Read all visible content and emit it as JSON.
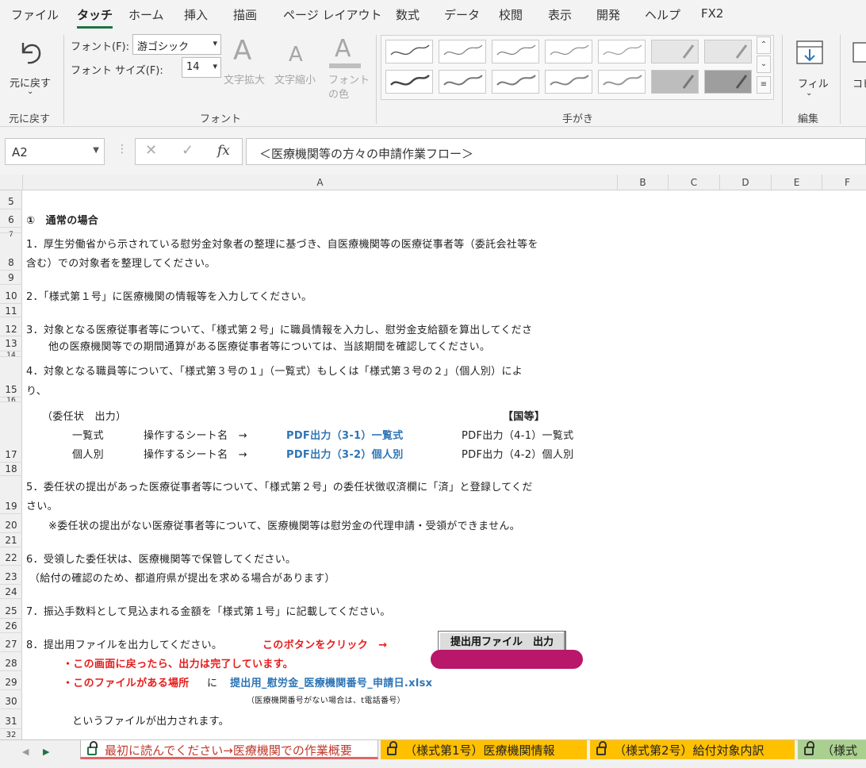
{
  "menu": {
    "tabs": [
      "ファイル",
      "タッチ",
      "ホーム",
      "挿入",
      "描画",
      "ページ レイアウト",
      "数式",
      "データ",
      "校閲",
      "表示",
      "開発",
      "ヘルプ",
      "FX2"
    ],
    "active": "タッチ"
  },
  "ribbon": {
    "undo": {
      "label": "元に戻す",
      "group": "元に戻す"
    },
    "font": {
      "font_label": "フォント(F):",
      "font_value": "游ゴシック",
      "size_label": "フォント サイズ(F):",
      "size_value": "14",
      "grow": "文字拡大",
      "shrink": "文字縮小",
      "color_line1": "フォント",
      "color_line2": "の色",
      "group": "フォント"
    },
    "handwriting": {
      "group": "手がき"
    },
    "edit": {
      "fill": "フィル",
      "group": "編集",
      "copy_partial": "コピ"
    }
  },
  "formula_bar": {
    "namebox": "A2",
    "fx": "fx",
    "formula": "＜医療機関等の方々の申請作業フロー＞"
  },
  "columns": [
    "A",
    "B",
    "C",
    "D",
    "E",
    "F"
  ],
  "rows": [
    "5",
    "6",
    "7",
    "8",
    "9",
    "10",
    "11",
    "12",
    "13",
    "14",
    "15",
    "16",
    "17",
    "18",
    "19",
    "20",
    "21",
    "22",
    "23",
    "24",
    "25",
    "26",
    "27",
    "28",
    "29",
    "30",
    "31",
    "32"
  ],
  "content": {
    "s1": "①　通常の場合",
    "p1a": "1．厚生労働省から示されている慰労金対象者の整理に基づき、自医療機関等の医療従事者等（委託会社等を",
    "p1b": "含む）での対象者を整理してください。",
    "p2": "2．「様式第１号」に医療機関の情報等を入力してください。",
    "p3a": "3．対象となる医療従事者等について、「様式第２号」に職員情報を入力し、慰労金支給額を算出してくださ",
    "p3b": "他の医療機関等での期間通算がある医療従事者等については、当該期間を確認してください。",
    "p4a": "4．対象となる職員等について、「様式第３号の１」（一覧式）もしくは「様式第３号の２」（個人別）によ",
    "p4b": "り、",
    "tbl_head_left": "（委任状　出力）",
    "tbl_head_right": "【国等】",
    "r1_type": "一覧式",
    "r1_op": "操作するシート名　→",
    "r1_link": "PDF出力（3-1）一覧式",
    "r1_gov": "PDF出力（4-1）一覧式",
    "r2_type": "個人別",
    "r2_op": "操作するシート名　→",
    "r2_link": "PDF出力（3-2）個人別",
    "r2_gov": "PDF出力（4-2）個人別",
    "p5a": "5．委任状の提出があった医療従事者等について、「様式第２号」の委任状徴収済欄に「済」と登録してくだ",
    "p5b": "さい。",
    "p5c": "※委任状の提出がない医療従事者等について、医療機関等は慰労金の代理申請・受領ができません。",
    "p6a": "6．受領した委任状は、医療機関等で保管してください。",
    "p6b": "（給付の確認のため、都道府県が提出を求める場合があります）",
    "p7": "7．振込手数料として見込まれる金額を「様式第１号」に記載してください。",
    "p8": "8．提出用ファイルを出力してください。",
    "p8_click": "このボタンをクリック　→",
    "p8_button": "提出用ファイル　出力",
    "p8_done": "・この画面に戻ったら、出力は完了しています。",
    "p8_loc_bullet": "・このファイルがある場所",
    "p8_loc_ni": "に",
    "p8_filename": "提出用_慰労金_医療機関番号_申請日.xlsx",
    "p8_note": "（医療機関番号がない場合は、t電話番号）",
    "p8_result": "というファイルが出力されます。"
  },
  "sheet_tabs": [
    {
      "label": "最初に読んでください→医療機関での作業概要",
      "color": "#ffffff",
      "text": "#c0392b",
      "underline": "#e06666",
      "locked": true
    },
    {
      "label": "（様式第1号）医療機関情報",
      "color": "#ffc000",
      "text": "#222222",
      "locked": true
    },
    {
      "label": "（様式第2号）給付対象内訳",
      "color": "#ffc000",
      "text": "#222222",
      "locked": true
    },
    {
      "label": "（様式",
      "color": "#a9d08e",
      "text": "#222222",
      "locked": true
    }
  ],
  "colors": {
    "accent": "#217346",
    "redact": "#b8176a",
    "red_text": "#e61c1c",
    "blue_text": "#2e75b6"
  }
}
